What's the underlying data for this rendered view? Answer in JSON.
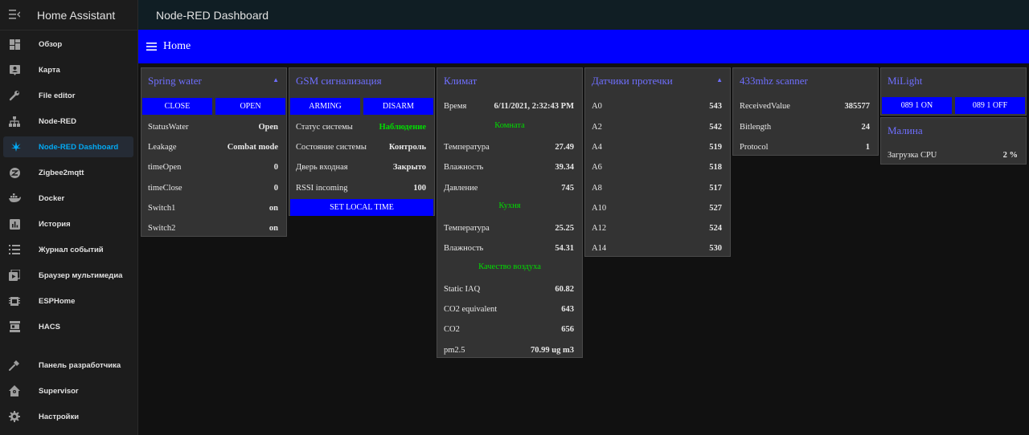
{
  "sidebar": {
    "title": "Home Assistant",
    "items": [
      {
        "label": "Обзор",
        "icon": "dashboard-icon"
      },
      {
        "label": "Карта",
        "icon": "map-account-icon"
      },
      {
        "label": "File editor",
        "icon": "wrench-icon"
      },
      {
        "label": "Node-RED",
        "icon": "sitemap-icon"
      },
      {
        "label": "Node-RED Dashboard",
        "icon": "cannabis-icon"
      },
      {
        "label": "Zigbee2mqtt",
        "icon": "zigbee-icon"
      },
      {
        "label": "Docker",
        "icon": "docker-icon"
      },
      {
        "label": "История",
        "icon": "chart-box-icon"
      },
      {
        "label": "Журнал событий",
        "icon": "format-list-icon"
      },
      {
        "label": "Браузер мультимедиа",
        "icon": "play-box-multiple-icon"
      },
      {
        "label": "ESPHome",
        "icon": "chip-icon"
      },
      {
        "label": "HACS",
        "icon": "hacs-icon"
      },
      {
        "label": "Панель разработчика",
        "icon": "hammer-icon"
      },
      {
        "label": "Supervisor",
        "icon": "home-assistant-icon"
      },
      {
        "label": "Настройки",
        "icon": "cog-icon"
      }
    ]
  },
  "topbar": {
    "title": "Node-RED Dashboard"
  },
  "dashboard": {
    "tab_title": "Home"
  },
  "cards": {
    "spring": {
      "title": "Spring water",
      "btn_close": "CLOSE",
      "btn_open": "OPEN",
      "rows": [
        {
          "label": "StatusWater",
          "value": "Open"
        },
        {
          "label": "Leakage",
          "value": "Combat mode"
        },
        {
          "label": "timeOpen",
          "value": "0"
        },
        {
          "label": "timeClose",
          "value": "0"
        },
        {
          "label": "Switch1",
          "value": "on"
        },
        {
          "label": "Switch2",
          "value": "on"
        }
      ]
    },
    "gsm": {
      "title": "GSM сигнализация",
      "btn_arming": "ARMING",
      "btn_disarm": "DISARM",
      "rows": [
        {
          "label": "Статус системы",
          "value": "Наблюдение"
        },
        {
          "label": "Состояние системы",
          "value": "Контроль"
        },
        {
          "label": "Дверь входная",
          "value": "Закрыто"
        },
        {
          "label": "RSSI incoming",
          "value": "100"
        }
      ],
      "btn_time": "SET LOCAL TIME"
    },
    "klimat": {
      "title": "Климат",
      "time_label": "Время",
      "time_value": "6/11/2021, 2:32:43 PM",
      "section_room": "Комната",
      "room_temp_label": "Температура",
      "room_temp": "27.49",
      "room_hum_label": "Влажность",
      "room_hum": "39.34",
      "room_press_label": "Давление",
      "room_press": "745",
      "section_kitchen": "Кухня",
      "kit_temp_label": "Температура",
      "kit_temp": "25.25",
      "kit_hum_label": "Влажность",
      "kit_hum": "54.31",
      "section_air": "Качество воздуха",
      "iaq_label": "Static IAQ",
      "iaq": "60.82",
      "co2eq_label": "CO2 equivalent",
      "co2eq": "643",
      "co2_label": "CO2",
      "co2": "656",
      "pm_label": "pm2.5",
      "pm": "70.99 ug m3"
    },
    "leak": {
      "title": "Датчики протечки",
      "rows": [
        {
          "label": "A0",
          "value": "543"
        },
        {
          "label": "A2",
          "value": "542"
        },
        {
          "label": "A4",
          "value": "519"
        },
        {
          "label": "A6",
          "value": "518"
        },
        {
          "label": "A8",
          "value": "517"
        },
        {
          "label": "A10",
          "value": "527"
        },
        {
          "label": "A12",
          "value": "524"
        },
        {
          "label": "A14",
          "value": "530"
        }
      ]
    },
    "scanner": {
      "title": "433mhz scanner",
      "rows": [
        {
          "label": "ReceivedValue",
          "value": "385577"
        },
        {
          "label": "Bitlength",
          "value": "24"
        },
        {
          "label": "Protocol",
          "value": "1"
        }
      ]
    },
    "milight": {
      "title": "MiLight",
      "btn_on": "089 1 ON",
      "btn_off": "089 1 OFF"
    },
    "malina": {
      "title": "Малина",
      "cpu_label": "Загрузка CPU",
      "cpu_value": "2 %"
    }
  },
  "colors": {
    "accent_blue": "#0000ff",
    "title_blue": "#6f6fff",
    "status_green": "#00dd00",
    "sidebar_active": "#03a9f4"
  }
}
